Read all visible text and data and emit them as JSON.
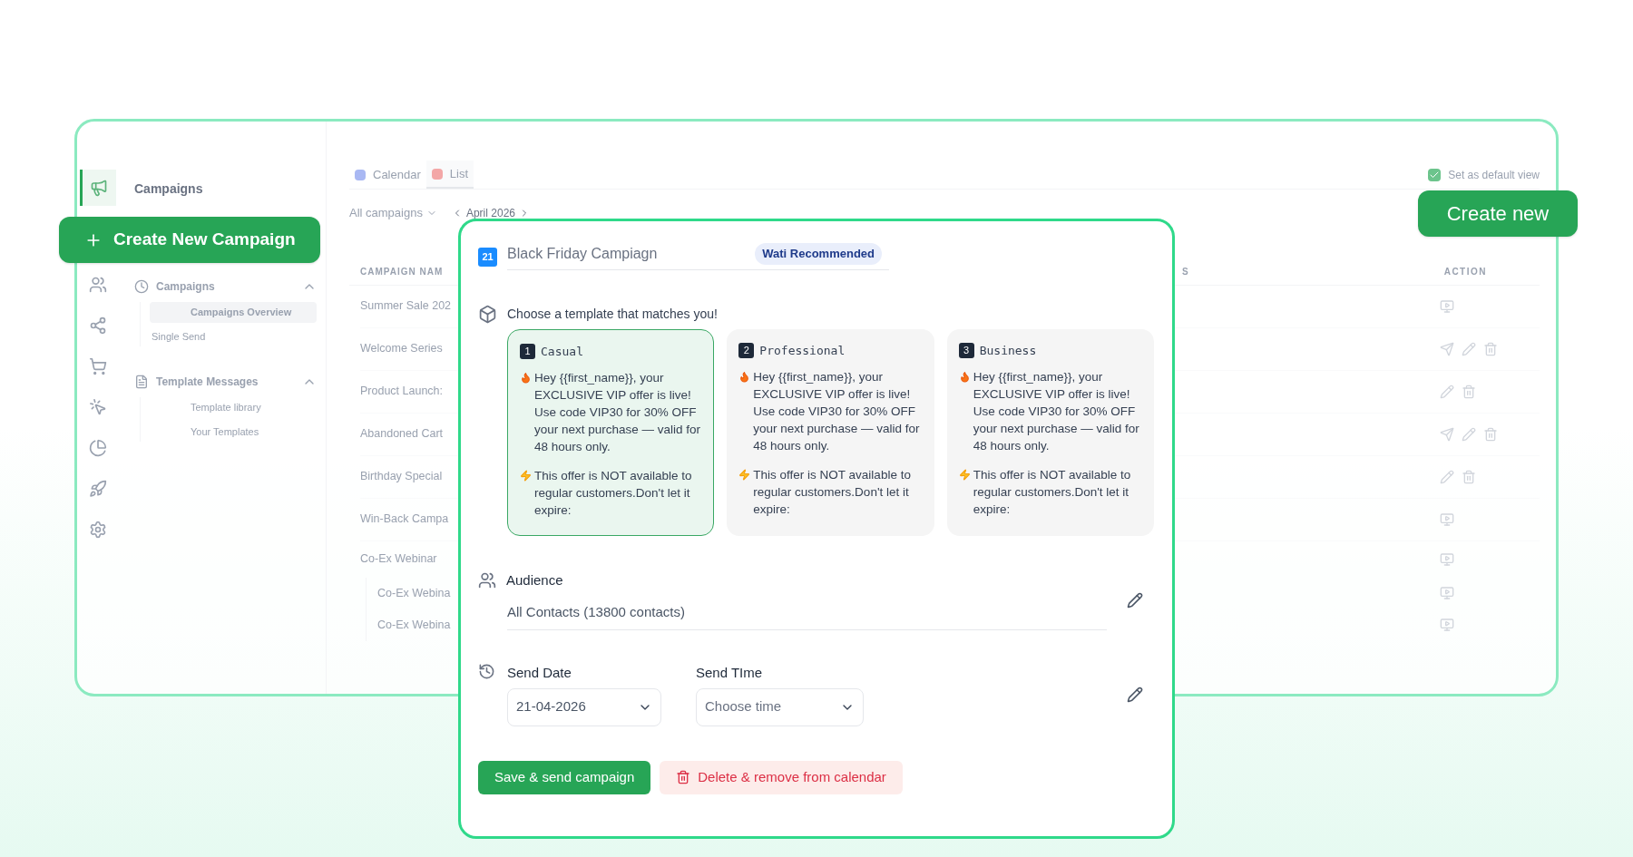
{
  "rail": [
    {
      "selected": true
    },
    {
      "selected": false
    },
    {
      "selected": false
    },
    {
      "selected": false
    },
    {
      "selected": false
    },
    {
      "selected": false
    },
    {
      "selected": false
    },
    {
      "selected": false
    }
  ],
  "sidebar": {
    "title": "Campaigns",
    "groups": [
      {
        "label": "Campaigns",
        "expanded": true,
        "children": [
          {
            "label": "Campaigns Overview",
            "selected": true
          },
          {
            "label": "Single Send",
            "selected": false
          }
        ]
      },
      {
        "label": "Template Messages",
        "expanded": true,
        "children": [
          {
            "label": "Template library",
            "selected": false
          },
          {
            "label": "Your Templates",
            "selected": false
          }
        ]
      }
    ]
  },
  "tabs": [
    {
      "label": "Calendar",
      "selected": false
    },
    {
      "label": "List",
      "selected": true
    }
  ],
  "default_view": {
    "label": "Set as default view",
    "checked": true
  },
  "filter": {
    "value": "All campaigns"
  },
  "month": "April 2026",
  "table": {
    "columns": [
      "CAMPAIGN NAM",
      "S",
      "ACTION"
    ],
    "rows": [
      {
        "name": "Summer Sale 202",
        "actions": [
          {
            "kind": "preview"
          }
        ]
      },
      {
        "name": "Welcome Series",
        "actions": [
          {
            "kind": "send"
          },
          {
            "kind": "edit"
          },
          {
            "kind": "delete"
          }
        ]
      },
      {
        "name": "Product Launch:",
        "actions": [
          {
            "kind": "edit"
          },
          {
            "kind": "delete"
          }
        ]
      },
      {
        "name": "Abandoned Cart",
        "actions": [
          {
            "kind": "send"
          },
          {
            "kind": "edit"
          },
          {
            "kind": "delete"
          }
        ]
      },
      {
        "name": "Birthday Special",
        "actions": [
          {
            "kind": "edit"
          },
          {
            "kind": "delete"
          }
        ]
      },
      {
        "name": "Win-Back Campa",
        "actions": [
          {
            "kind": "preview"
          }
        ]
      },
      {
        "name": "Co-Ex Webinar",
        "actions": [
          {
            "kind": "preview"
          }
        ],
        "children": [
          {
            "name": "Co-Ex Webina",
            "actions": [
              {
                "kind": "preview"
              }
            ]
          },
          {
            "name": "Co-Ex Webina",
            "actions": [
              {
                "kind": "preview"
              }
            ]
          }
        ]
      }
    ]
  },
  "create_campaign_button": "Create New Campaign",
  "create_new_button": "Create new",
  "modal": {
    "date_badge": "21",
    "title": "Black Friday Campiagn",
    "tag": "Wati Recommended",
    "template_prompt": "Choose a template that matches you!",
    "templates": [
      {
        "number": "1",
        "name": "Casual",
        "selected": true,
        "message": "Hey {{first_name}}, your EXCLUSIVE VIP offer is live! Use code VIP30 for 30% OFF your next purchase — valid for 48 hours only.",
        "note": "This offer is NOT available to regular customers.Don't let it expire:"
      },
      {
        "number": "2",
        "name": "Professional",
        "selected": false,
        "message": "Hey {{first_name}}, your EXCLUSIVE VIP offer is live! Use code VIP30 for 30% OFF your next purchase — valid for 48 hours only.",
        "note": "This offer is NOT available to regular customers.Don't let it expire:"
      },
      {
        "number": "3",
        "name": "Business",
        "selected": false,
        "message": "Hey {{first_name}}, your EXCLUSIVE VIP offer is live! Use code VIP30 for 30% OFF your next purchase — valid for 48 hours only.",
        "note": "This offer is NOT available to regular customers.Don't let it expire:"
      }
    ],
    "audience": {
      "label": "Audience",
      "value": "All Contacts (13800 contacts)"
    },
    "send_date": {
      "label": "Send Date",
      "value": "21-04-2026"
    },
    "send_time": {
      "label": "Send TIme",
      "placeholder": "Choose time"
    },
    "save_button": "Save & send campaign",
    "delete_button": "Delete & remove from calendar"
  }
}
